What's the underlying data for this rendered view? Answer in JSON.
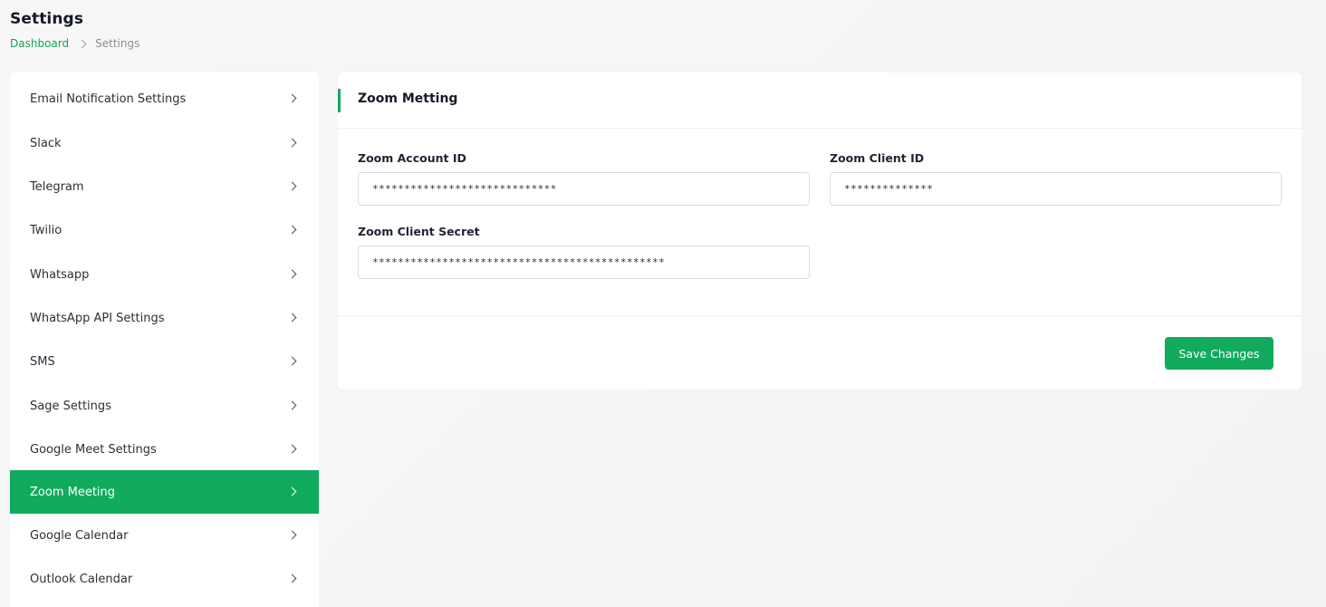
{
  "header": {
    "title": "Settings",
    "breadcrumb": {
      "home": "Dashboard",
      "current": "Settings"
    }
  },
  "sidebar": {
    "items": [
      {
        "label": "Email Notification Settings",
        "active": false
      },
      {
        "label": "Slack",
        "active": false
      },
      {
        "label": "Telegram",
        "active": false
      },
      {
        "label": "Twilio",
        "active": false
      },
      {
        "label": "Whatsapp",
        "active": false
      },
      {
        "label": "WhatsApp API Settings",
        "active": false
      },
      {
        "label": "SMS",
        "active": false
      },
      {
        "label": "Sage Settings",
        "active": false
      },
      {
        "label": "Google Meet Settings",
        "active": false
      },
      {
        "label": "Zoom Meeting",
        "active": true
      },
      {
        "label": "Google Calendar",
        "active": false
      },
      {
        "label": "Outlook Calendar",
        "active": false
      }
    ]
  },
  "card": {
    "title": "Zoom Metting",
    "fields": {
      "account_id": {
        "label": "Zoom Account ID",
        "value": "*****************************"
      },
      "client_id": {
        "label": "Zoom Client ID",
        "value": "**************"
      },
      "client_secret": {
        "label": "Zoom Client Secret",
        "value": "**********************************************"
      }
    },
    "save_label": "Save Changes"
  },
  "colors": {
    "accent": "#12ab5e",
    "link": "#12a35b"
  },
  "icons": {
    "breadcrumb_separator": "chevron-right-icon",
    "sidebar_item": "chevron-right-icon"
  }
}
